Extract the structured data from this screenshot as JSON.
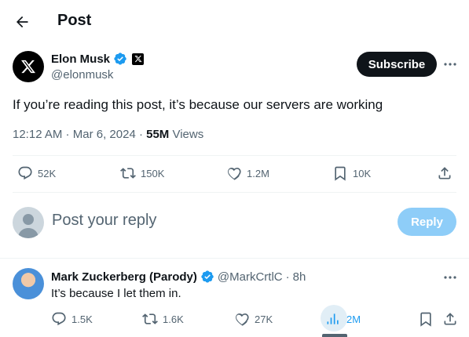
{
  "header": {
    "title": "Post"
  },
  "post": {
    "author_name": "Elon Musk",
    "author_handle": "@elonmusk",
    "subscribe_label": "Subscribe",
    "text": "If you’re reading this post, it’s because our servers are working",
    "time": "12:12 AM",
    "date": "Mar 6, 2024",
    "views_count": "55M",
    "views_label": "Views",
    "stats": {
      "replies": "52K",
      "reposts": "150K",
      "likes": "1.2M",
      "bookmarks": "10K"
    }
  },
  "composer": {
    "placeholder": "Post your reply",
    "button_label": "Reply"
  },
  "reply": {
    "author_name": "Mark Zuckerberg (Parody)",
    "author_handle": "@MarkCrtlC",
    "age": "8h",
    "text": "It’s because I let them in.",
    "stats": {
      "replies": "1.5K",
      "reposts": "1.6K",
      "likes": "27K",
      "views": "2M"
    }
  },
  "colors": {
    "accent": "#1d9bf0",
    "verified": "#1d9bf0",
    "text": "#0f1419",
    "muted": "#536471",
    "reply_button": "#8ecdf8"
  }
}
